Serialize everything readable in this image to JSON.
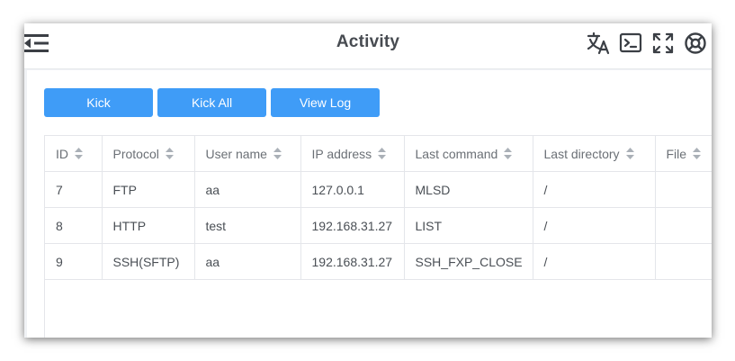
{
  "header": {
    "title": "Activity"
  },
  "toolbar": {
    "icons": [
      "translate-icon",
      "terminal-icon",
      "fullscreen-icon",
      "help-lifebuoy-icon"
    ]
  },
  "actions": {
    "kick_label": "Kick",
    "kick_all_label": "Kick All",
    "view_log_label": "View Log"
  },
  "colors": {
    "accent": "#3f9cf7",
    "header_text": "#474b51",
    "icon": "#3b3f45"
  },
  "table": {
    "columns": [
      "ID",
      "Protocol",
      "User name",
      "IP address",
      "Last command",
      "Last directory",
      "File"
    ],
    "rows": [
      {
        "id": "7",
        "protocol": "FTP",
        "user": "aa",
        "ip": "127.0.0.1",
        "command": "MLSD",
        "directory": "/",
        "file": ""
      },
      {
        "id": "8",
        "protocol": "HTTP",
        "user": "test",
        "ip": "192.168.31.27",
        "command": "LIST",
        "directory": "/",
        "file": ""
      },
      {
        "id": "9",
        "protocol": "SSH(SFTP)",
        "user": "aa",
        "ip": "192.168.31.27",
        "command": "SSH_FXP_CLOSE",
        "directory": "/",
        "file": ""
      }
    ]
  }
}
